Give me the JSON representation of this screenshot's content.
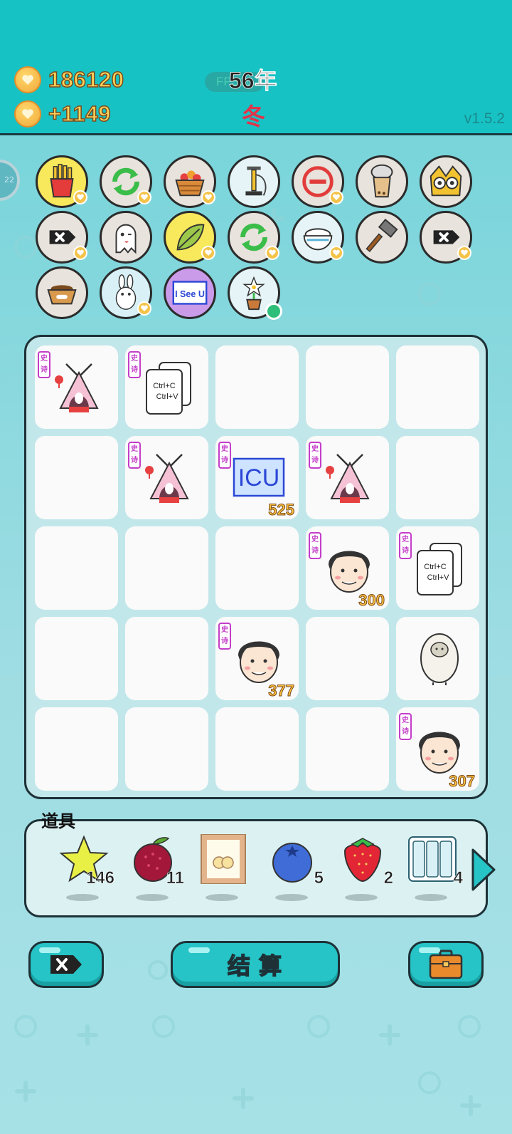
{
  "header": {
    "coins": "186120",
    "income": "+1149",
    "fps": "FPS30",
    "year": "56年",
    "season": "冬",
    "version": "v1.5.2"
  },
  "side_badge": "22",
  "relics": [
    {
      "icon": "fries-icon"
    },
    {
      "icon": "recycle-icon"
    },
    {
      "icon": "fruit-basket-icon"
    },
    {
      "icon": "air-pump-icon"
    },
    {
      "icon": "minus-icon"
    },
    {
      "icon": "bubble-tea-icon"
    },
    {
      "icon": "owl-icon"
    },
    {
      "icon": "remove-tag-icon"
    },
    {
      "icon": "ghost-icon"
    },
    {
      "icon": "leaf-icon"
    },
    {
      "icon": "recycle-icon"
    },
    {
      "icon": "rice-bowl-icon"
    },
    {
      "icon": "hammer-icon"
    },
    {
      "icon": "remove-tag-icon"
    },
    {
      "icon": "pet-bowl-icon"
    },
    {
      "icon": "bunny-icon"
    },
    {
      "icon": "i-see-u-icon",
      "label": "I See U"
    },
    {
      "icon": "potted-flower-icon"
    }
  ],
  "board": {
    "tag_text": "史诗",
    "cells": [
      {
        "item": "bunny-tent",
        "tag": true,
        "count": ""
      },
      {
        "item": "ctrl-cv",
        "tag": true,
        "count": "",
        "line1": "Ctrl+C",
        "line2": "Ctrl+V"
      },
      {
        "item": "",
        "tag": false,
        "count": ""
      },
      {
        "item": "",
        "tag": false,
        "count": ""
      },
      {
        "item": "",
        "tag": false,
        "count": ""
      },
      {
        "item": "",
        "tag": false,
        "count": ""
      },
      {
        "item": "bunny-tent",
        "tag": true,
        "count": ""
      },
      {
        "item": "icu",
        "tag": true,
        "count": "525",
        "label": "ICU"
      },
      {
        "item": "bunny-tent",
        "tag": true,
        "count": ""
      },
      {
        "item": "",
        "tag": false,
        "count": ""
      },
      {
        "item": "",
        "tag": false,
        "count": ""
      },
      {
        "item": "",
        "tag": false,
        "count": ""
      },
      {
        "item": "",
        "tag": false,
        "count": ""
      },
      {
        "item": "face",
        "tag": true,
        "count": "300"
      },
      {
        "item": "ctrl-cv",
        "tag": true,
        "count": "",
        "line1": "Ctrl+C",
        "line2": "Ctrl+V"
      },
      {
        "item": "",
        "tag": false,
        "count": ""
      },
      {
        "item": "",
        "tag": false,
        "count": ""
      },
      {
        "item": "face",
        "tag": true,
        "count": "377"
      },
      {
        "item": "",
        "tag": false,
        "count": ""
      },
      {
        "item": "sheep",
        "tag": false,
        "count": ""
      },
      {
        "item": "",
        "tag": false,
        "count": ""
      },
      {
        "item": "",
        "tag": false,
        "count": ""
      },
      {
        "item": "",
        "tag": false,
        "count": ""
      },
      {
        "item": "",
        "tag": false,
        "count": ""
      },
      {
        "item": "face",
        "tag": true,
        "count": "307"
      }
    ]
  },
  "props": {
    "title": "道具",
    "items": [
      {
        "icon": "star-icon",
        "count": "146"
      },
      {
        "icon": "bayberry-icon",
        "count": "11"
      },
      {
        "icon": "framed-picture-icon",
        "count": ""
      },
      {
        "icon": "blueberry-icon",
        "count": "5"
      },
      {
        "icon": "strawberry-icon",
        "count": "2"
      },
      {
        "icon": "triple-slot-icon",
        "count": "4"
      }
    ]
  },
  "buttons": {
    "settle": "结算"
  },
  "colors": {
    "teal": "#17c2c4",
    "epic_tag": "#c43ec9",
    "count_gold": "#ffc23d"
  }
}
